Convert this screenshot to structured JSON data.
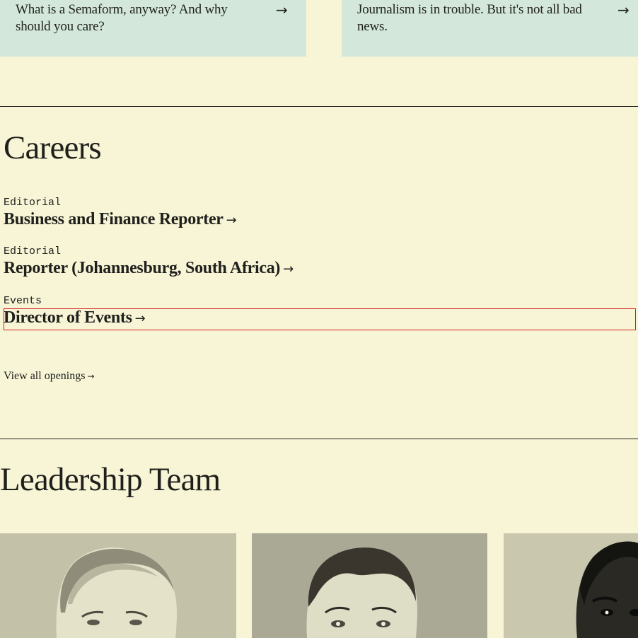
{
  "articles": [
    {
      "title": "What is a Semaform, anyway? And why should you care?",
      "arrow": "→"
    },
    {
      "title": "Journalism is in trouble. But it's not all bad news.",
      "arrow": "→"
    }
  ],
  "careers": {
    "heading": "Careers",
    "jobs": [
      {
        "department": "Editorial",
        "title": "Business and Finance Reporter",
        "arrow": "→"
      },
      {
        "department": "Editorial",
        "title": "Reporter (Johannesburg, South Africa)",
        "arrow": "→"
      },
      {
        "department": "Events",
        "title": "Director of Events",
        "arrow": "→"
      }
    ],
    "view_all": {
      "label": "View all openings",
      "arrow": "→"
    }
  },
  "leadership": {
    "heading": "Leadership Team"
  }
}
